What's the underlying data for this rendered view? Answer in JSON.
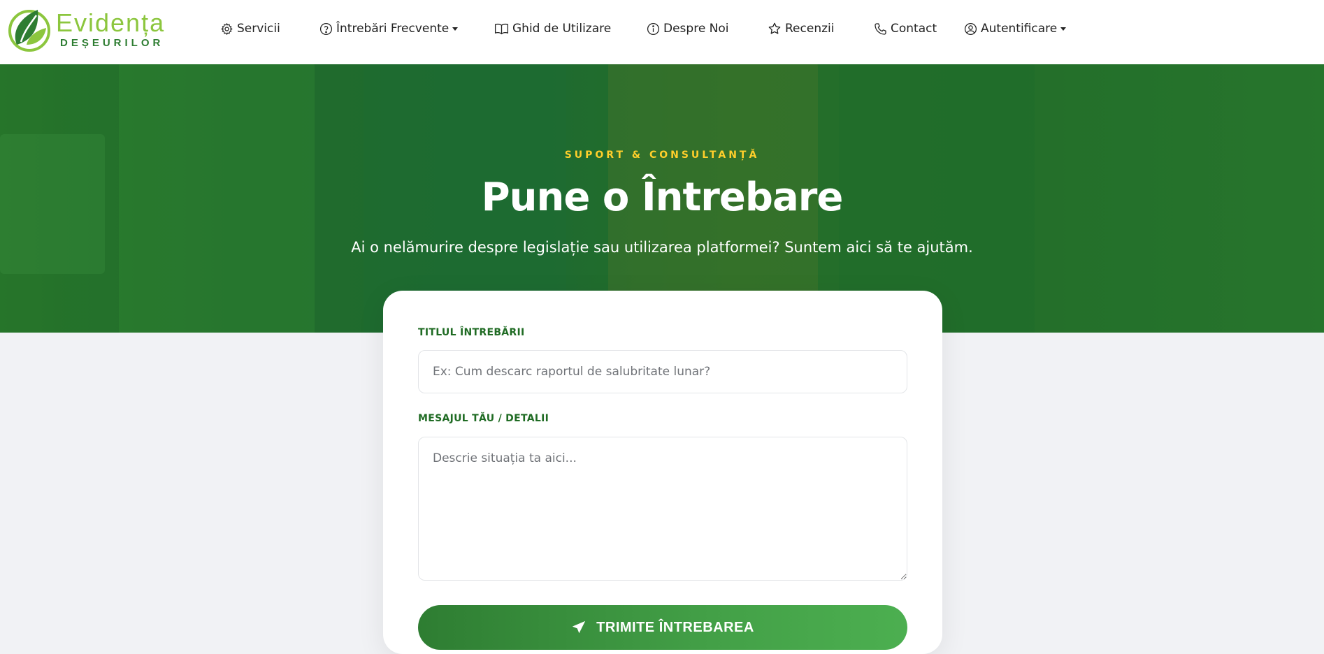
{
  "brand": {
    "name": "Evidența",
    "tagline": "DEȘEURILOR",
    "colors": {
      "primary": "#8cc63e",
      "dark": "#2e7d32"
    }
  },
  "nav": {
    "items": [
      {
        "label": "Servicii",
        "icon": "gear-icon",
        "dropdown": false
      },
      {
        "label": "Întrebări Frecvente",
        "icon": "question-circle-icon",
        "dropdown": true
      },
      {
        "label": "Ghid de Utilizare",
        "icon": "book-icon",
        "dropdown": false
      },
      {
        "label": "Despre Noi",
        "icon": "info-circle-icon",
        "dropdown": false
      },
      {
        "label": "Recenzii",
        "icon": "star-icon",
        "dropdown": false
      },
      {
        "label": "Contact",
        "icon": "phone-icon",
        "dropdown": false
      },
      {
        "label": "Autentificare",
        "icon": "user-circle-icon",
        "dropdown": true
      }
    ]
  },
  "hero": {
    "eyebrow": "SUPORT & CONSULTANȚĂ",
    "title": "Pune o Întrebare",
    "subtitle": "Ai o nelămurire despre legislație sau utilizarea platformei? Suntem aici să te ajutăm.",
    "accent": "#ffcf2b"
  },
  "form": {
    "title_label": "TITLUL ÎNTREBĂRII",
    "title_placeholder": "Ex: Cum descarc raportul de salubritate lunar?",
    "title_value": "",
    "message_label": "MESAJUL TĂU / DETALII",
    "message_placeholder": "Descrie situația ta aici...",
    "message_value": "",
    "submit_label": "TRIMITE ÎNTREBAREA"
  }
}
